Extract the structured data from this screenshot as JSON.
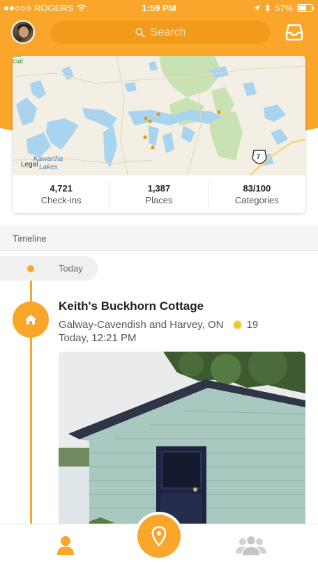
{
  "status_bar": {
    "carrier": "ROGERS",
    "time": "1:59 PM",
    "battery": "57%",
    "battery_level": 0.57
  },
  "header": {
    "search_placeholder": "Search",
    "avatar": "user-avatar",
    "inbox_icon": "inbox-tray-icon"
  },
  "map": {
    "labels": {
      "legal": "Legal",
      "lake": "Kawartha Lakes",
      "lake_line1": "Kawartha",
      "lake_line2": "Lakes",
      "corner_fragment_1": "us",
      "corner_fragment_2": "cial",
      "highway": "7"
    }
  },
  "stats": [
    {
      "value": "4,721",
      "label": "Check-ins"
    },
    {
      "value": "1,387",
      "label": "Places"
    },
    {
      "value": "83/100",
      "label": "Categories"
    }
  ],
  "timeline": {
    "header": "Timeline",
    "day_label": "Today",
    "entries": [
      {
        "title": "Keith's Buckhorn Cottage",
        "location": "Galway-Cavendish and Harvey, ON",
        "coins": "19",
        "time": "Today, 12:21 PM",
        "icon": "home-icon"
      }
    ]
  },
  "tabbar": {
    "left_icon": "profile-icon",
    "center_icon": "location-pin-icon",
    "right_icon": "friends-icon"
  },
  "colors": {
    "accent": "#f9a62b",
    "search_bg": "#f29a1c"
  }
}
